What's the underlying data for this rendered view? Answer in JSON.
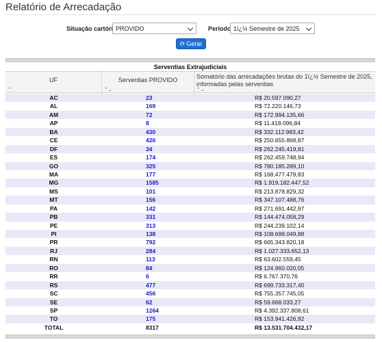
{
  "page": {
    "title": "Relatório de Arrecadação"
  },
  "filters": {
    "situacao_label": "Situação cartório",
    "situacao_value": "PROVIDO",
    "periodo_label": "Período",
    "periodo_value": "1ï¿½ Semestre de 2025",
    "gerar_label": "Gerar",
    "gerar_icon": "refresh-icon"
  },
  "table": {
    "caption": "Serventias Extrajudiciais",
    "columns": [
      "UF",
      "Serventias PROVIDO",
      "Somatório das arrecadações brutas do 1ï¿½ Semestre de 2025, informadas pelas serventias"
    ],
    "sort_glyphs": [
      "⌃",
      "⌃⌄",
      "⌃⌄"
    ],
    "rows": [
      {
        "uf": "AC",
        "count": "23",
        "value": "R$ 20.597.090,27"
      },
      {
        "uf": "AL",
        "count": "169",
        "value": "R$ 72.220.146,73"
      },
      {
        "uf": "AM",
        "count": "72",
        "value": "R$ 172.994.135,66"
      },
      {
        "uf": "AP",
        "count": "8",
        "value": "R$ 11.418.096,84"
      },
      {
        "uf": "BA",
        "count": "430",
        "value": "R$ 332.112.983,42"
      },
      {
        "uf": "CE",
        "count": "426",
        "value": "R$ 250.655.868,87"
      },
      {
        "uf": "DF",
        "count": "34",
        "value": "R$ 262.245.419,81"
      },
      {
        "uf": "ES",
        "count": "174",
        "value": "R$ 262.459.748,94"
      },
      {
        "uf": "GO",
        "count": "325",
        "value": "R$ 780.185.289,10"
      },
      {
        "uf": "MA",
        "count": "177",
        "value": "R$ 168.477.479,83"
      },
      {
        "uf": "MG",
        "count": "1585",
        "value": "R$ 1.919.182.447,52"
      },
      {
        "uf": "MS",
        "count": "101",
        "value": "R$ 213.878.829,32"
      },
      {
        "uf": "MT",
        "count": "156",
        "value": "R$ 347.107.488,76"
      },
      {
        "uf": "PA",
        "count": "142",
        "value": "R$ 271.691.442,97"
      },
      {
        "uf": "PB",
        "count": "331",
        "value": "R$ 144.474.058,29"
      },
      {
        "uf": "PE",
        "count": "313",
        "value": "R$ 244.239.102,14"
      },
      {
        "uf": "PI",
        "count": "138",
        "value": "R$ 108.699.049,88"
      },
      {
        "uf": "PR",
        "count": "792",
        "value": "R$ 665.343.820,18"
      },
      {
        "uf": "RJ",
        "count": "284",
        "value": "R$ 1.027.333.652,13"
      },
      {
        "uf": "RN",
        "count": "113",
        "value": "R$ 63.602.559,45"
      },
      {
        "uf": "RO",
        "count": "84",
        "value": "R$ 124.960.020,05"
      },
      {
        "uf": "RR",
        "count": "6",
        "value": "R$ 6.767.370,76"
      },
      {
        "uf": "RS",
        "count": "477",
        "value": "R$ 699.733.317,40"
      },
      {
        "uf": "SC",
        "count": "456",
        "value": "R$ 755.357.745,05"
      },
      {
        "uf": "SE",
        "count": "62",
        "value": "R$ 59.668.033,27"
      },
      {
        "uf": "SP",
        "count": "1264",
        "value": "R$ 4.392.337.808,61"
      },
      {
        "uf": "TO",
        "count": "175",
        "value": "R$ 153.941.426,92"
      }
    ],
    "total": {
      "label": "TOTAL",
      "count": "8317",
      "value": "R$ 13.531.704.432,17"
    }
  },
  "colors": {
    "accent": "#1f6fd6",
    "count_link": "#1818c8",
    "row_stripe": "#e7e9f7"
  }
}
